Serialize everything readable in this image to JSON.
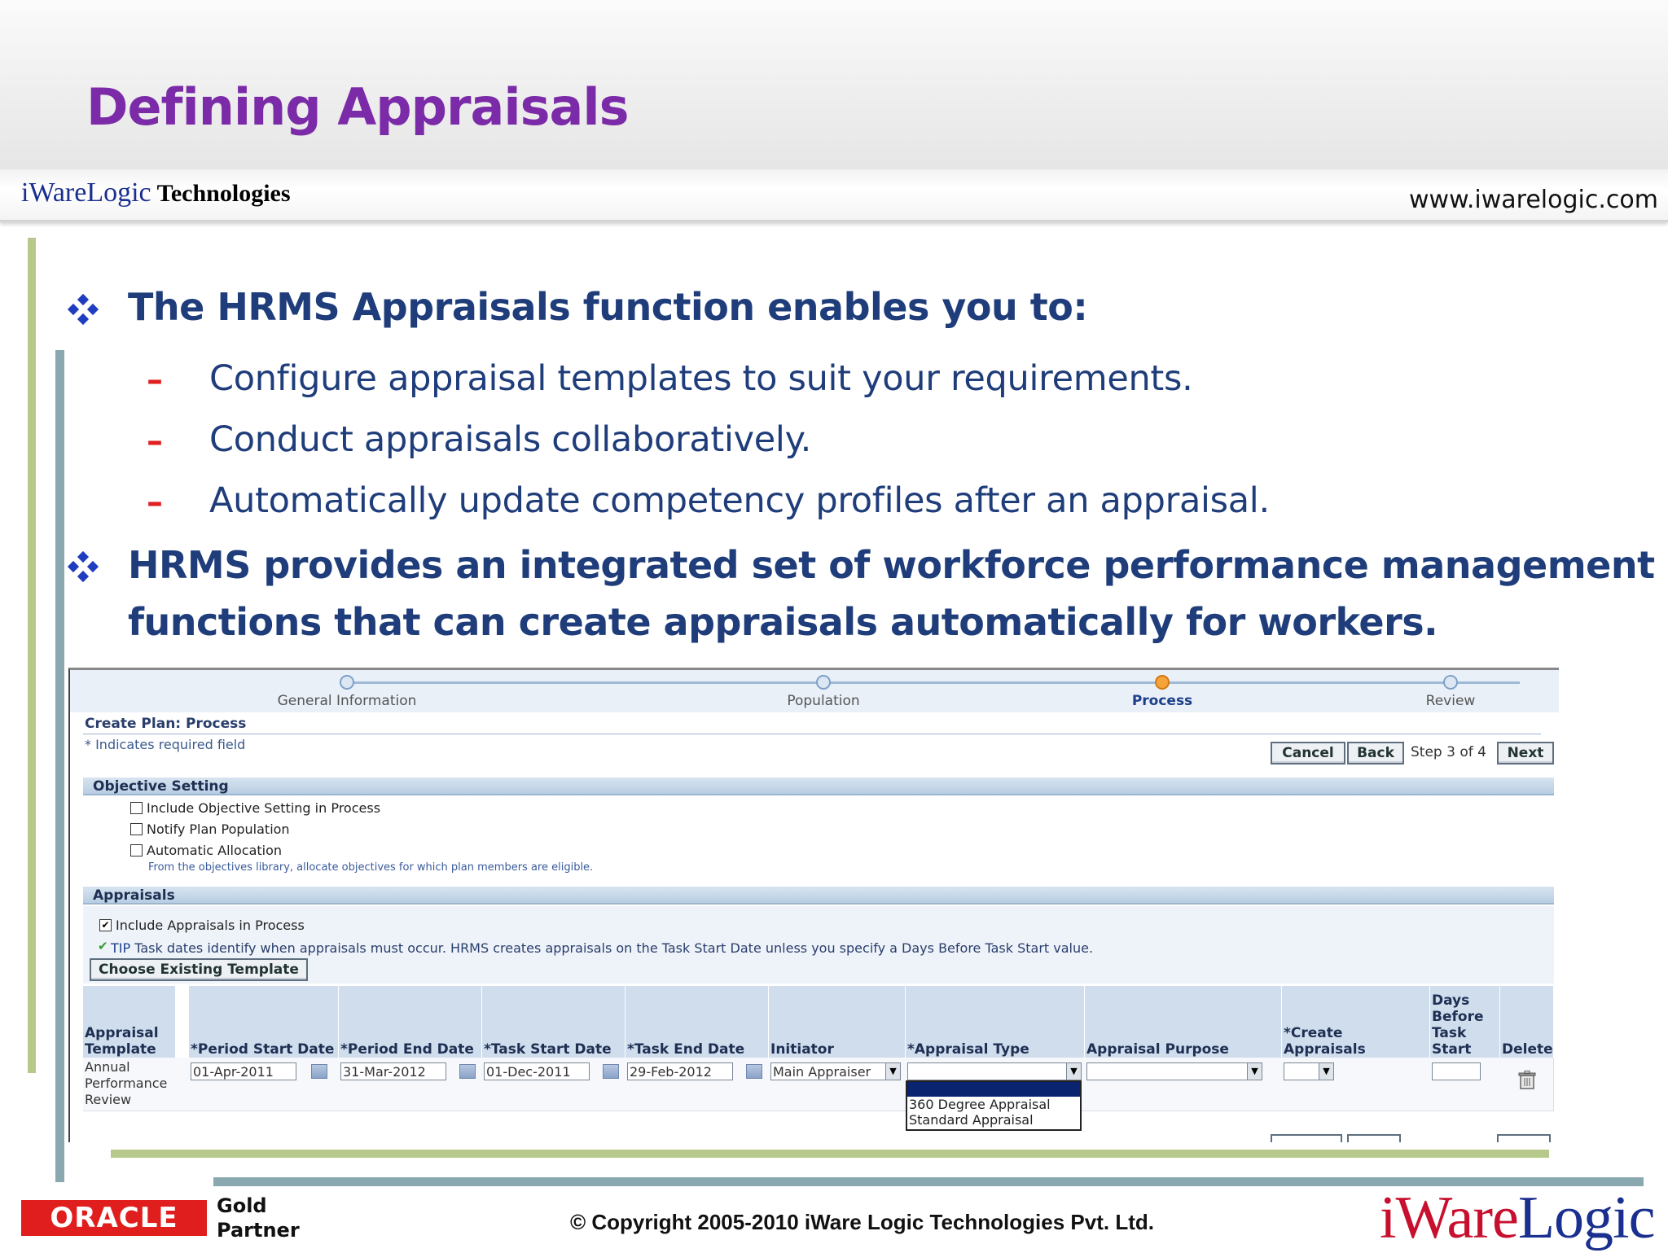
{
  "slide": {
    "title": "Defining Appraisals",
    "brand_small": {
      "part1": "iWare",
      "part2": "Logic",
      "part3": " Technologies"
    },
    "website": "www.iwarelogic.com",
    "bullets": [
      {
        "text": "The HRMS Appraisals function enables you to:"
      },
      {
        "text_line1": "HRMS provides an integrated set of workforce performance management",
        "text_line2": "functions that can create appraisals automatically for workers."
      }
    ],
    "sub_bullets": [
      "Configure appraisal templates to suit your requirements.",
      "Conduct appraisals collaboratively.",
      "Automatically update competency profiles after an appraisal."
    ],
    "dash_char": "–",
    "footer": {
      "oracle_logo_text": "ORACLE",
      "partner_line1": "Gold",
      "partner_line2": "Partner",
      "copyright": "© Copyright 2005-2010 iWare Logic Technologies Pvt. Ltd.",
      "brand_large": {
        "part1": "iWare",
        "part2": "Logic"
      }
    },
    "colors": {
      "title": "#7b2aa8",
      "bullet_text": "#1f3d7a",
      "dash": "#e02020",
      "oracle_red": "#e01e1e"
    }
  },
  "app": {
    "train": {
      "steps": [
        "General Information",
        "Population",
        "Process",
        "Review"
      ],
      "current": "Process"
    },
    "page_title": "Create Plan: Process",
    "required_note": "* Indicates required field",
    "buttons": {
      "cancel": "Cancel",
      "back": "Back",
      "next": "Next"
    },
    "step_info": "Step 3 of 4",
    "objective_section": {
      "header": "Objective Setting",
      "checkboxes": [
        {
          "label": "Include Objective Setting in Process",
          "checked": false
        },
        {
          "label": "Notify Plan Population",
          "checked": false
        },
        {
          "label": "Automatic Allocation",
          "checked": false
        }
      ],
      "hint": "From the objectives library, allocate objectives for which plan members are eligible."
    },
    "appraisals_section": {
      "header": "Appraisals",
      "include_label": "Include Appraisals in Process",
      "include_checked": true,
      "check_mark": "✔",
      "tip_label": "TIP",
      "tip_text": " Task dates identify when appraisals must occur. HRMS creates appraisals on the Task Start Date unless you specify a Days Before Task Start value.",
      "choose_button": "Choose Existing Template"
    },
    "table": {
      "headers": {
        "template_line1": "Appraisal",
        "template_line2": "Template",
        "period_start": "*Period Start Date",
        "period_end": "*Period End Date",
        "task_start": "*Task Start Date",
        "task_end": "*Task End Date",
        "initiator": "Initiator",
        "appraisal_type": "*Appraisal Type",
        "appraisal_purpose": "Appraisal Purpose",
        "create_appraisals": "*Create Appraisals",
        "days_before_line1": "Days",
        "days_before_line2": "Before",
        "days_before_line3": "Task",
        "days_before_line4": "Start",
        "delete": "Delete"
      },
      "row": {
        "template_line1": "Annual",
        "template_line2": "Performance",
        "template_line3": "Review",
        "period_start": "01-Apr-2011",
        "period_end": "31-Mar-2012",
        "task_start": "01-Dec-2011",
        "task_end": "29-Feb-2012",
        "initiator": "Main Appraiser",
        "appraisal_type": "",
        "appraisal_purpose": "",
        "create_appraisals": "",
        "days_before": ""
      },
      "dropdown_options": [
        "",
        "360 Degree Appraisal",
        "Standard Appraisal"
      ],
      "dropdown_arrow": "▼"
    }
  }
}
